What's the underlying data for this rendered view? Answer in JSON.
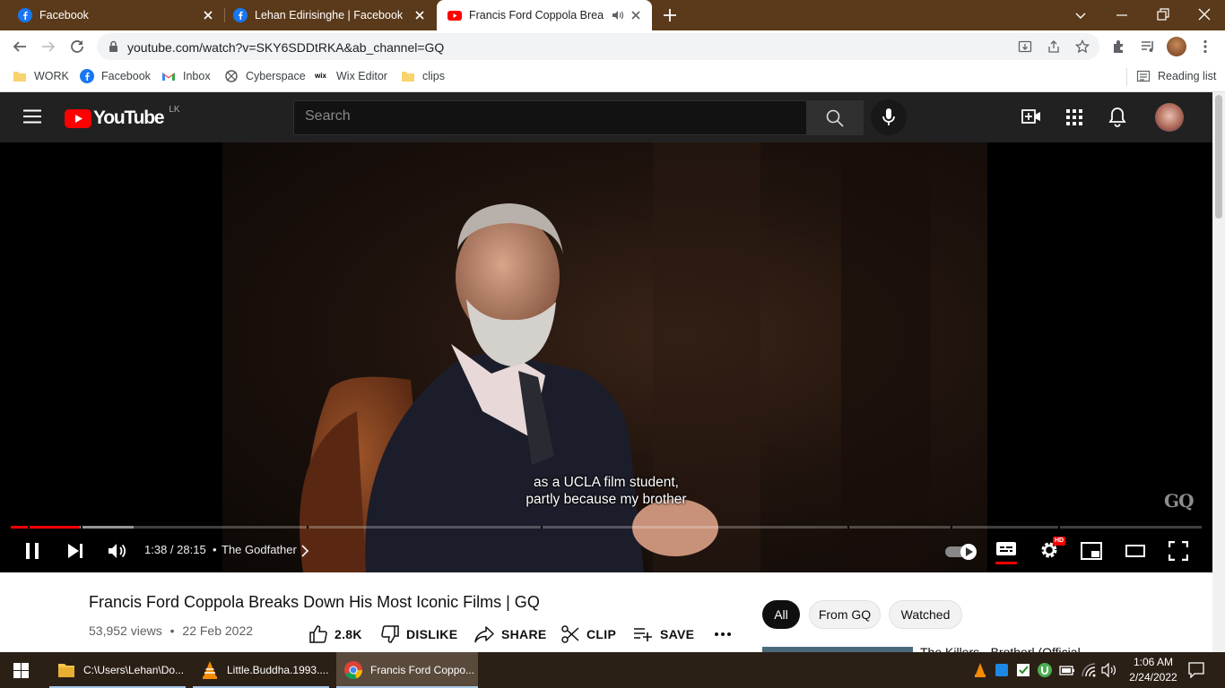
{
  "browser": {
    "tabs": [
      {
        "title": "Facebook",
        "icon": "facebook-icon",
        "active": false
      },
      {
        "title": "Lehan Edirisinghe | Facebook",
        "icon": "facebook-icon",
        "active": false
      },
      {
        "title": "Francis Ford Coppola Breaks",
        "icon": "youtube-icon",
        "active": true,
        "audio": true
      }
    ],
    "url": "youtube.com/watch?v=SKY6SDDtRKA&ab_channel=GQ",
    "bookmarks": [
      {
        "label": "WORK",
        "icon": "folder-icon"
      },
      {
        "label": "Facebook",
        "icon": "facebook-icon"
      },
      {
        "label": "Inbox",
        "icon": "gmail-icon"
      },
      {
        "label": "Cyberspace",
        "icon": "cyberspace-icon"
      },
      {
        "label": "Wix Editor",
        "icon": "wix-icon"
      },
      {
        "label": "clips",
        "icon": "folder-icon"
      }
    ],
    "reading_list": "Reading list"
  },
  "youtube": {
    "logo_text": "YouTube",
    "country_code": "LK",
    "search_placeholder": "Search"
  },
  "player": {
    "subtitle_lines": [
      "as a UCLA film student,",
      "partly because my brother"
    ],
    "watermark": "GQ",
    "current_time": "1:38",
    "duration": "28:15",
    "time_display": "1:38 / 28:15",
    "chapter_separator": "•",
    "chapter": "The Godfather",
    "played_fraction": 0.058,
    "buffered_fraction": 0.103,
    "quality_badge": "HD"
  },
  "video": {
    "title": "Francis Ford Coppola Breaks Down His Most Iconic Films | GQ",
    "views": "53,952 views",
    "meta_separator": "•",
    "date": "22 Feb 2022",
    "like_count": "2.8K",
    "dislike_label": "DISLIKE",
    "share_label": "SHARE",
    "clip_label": "CLIP",
    "save_label": "SAVE"
  },
  "recommendations": {
    "chips": [
      "All",
      "From GQ",
      "Watched"
    ],
    "selected_chip": "All",
    "first_title_partial": "The Killers - Brotherl (Official"
  },
  "taskbar": {
    "apps": [
      {
        "label": "C:\\Users\\Lehan\\Do...",
        "icon": "file-explorer-icon"
      },
      {
        "label": "Little.Buddha.1993....",
        "icon": "vlc-icon"
      },
      {
        "label": "Francis Ford Coppo...",
        "icon": "chrome-icon",
        "active": true
      }
    ],
    "time": "1:06 AM",
    "date": "2/24/2022"
  },
  "colors": {
    "tabstrip": "#5a3a1a",
    "youtube_red": "#ff0000",
    "masthead": "#212121",
    "taskbar": "#2b2016"
  }
}
